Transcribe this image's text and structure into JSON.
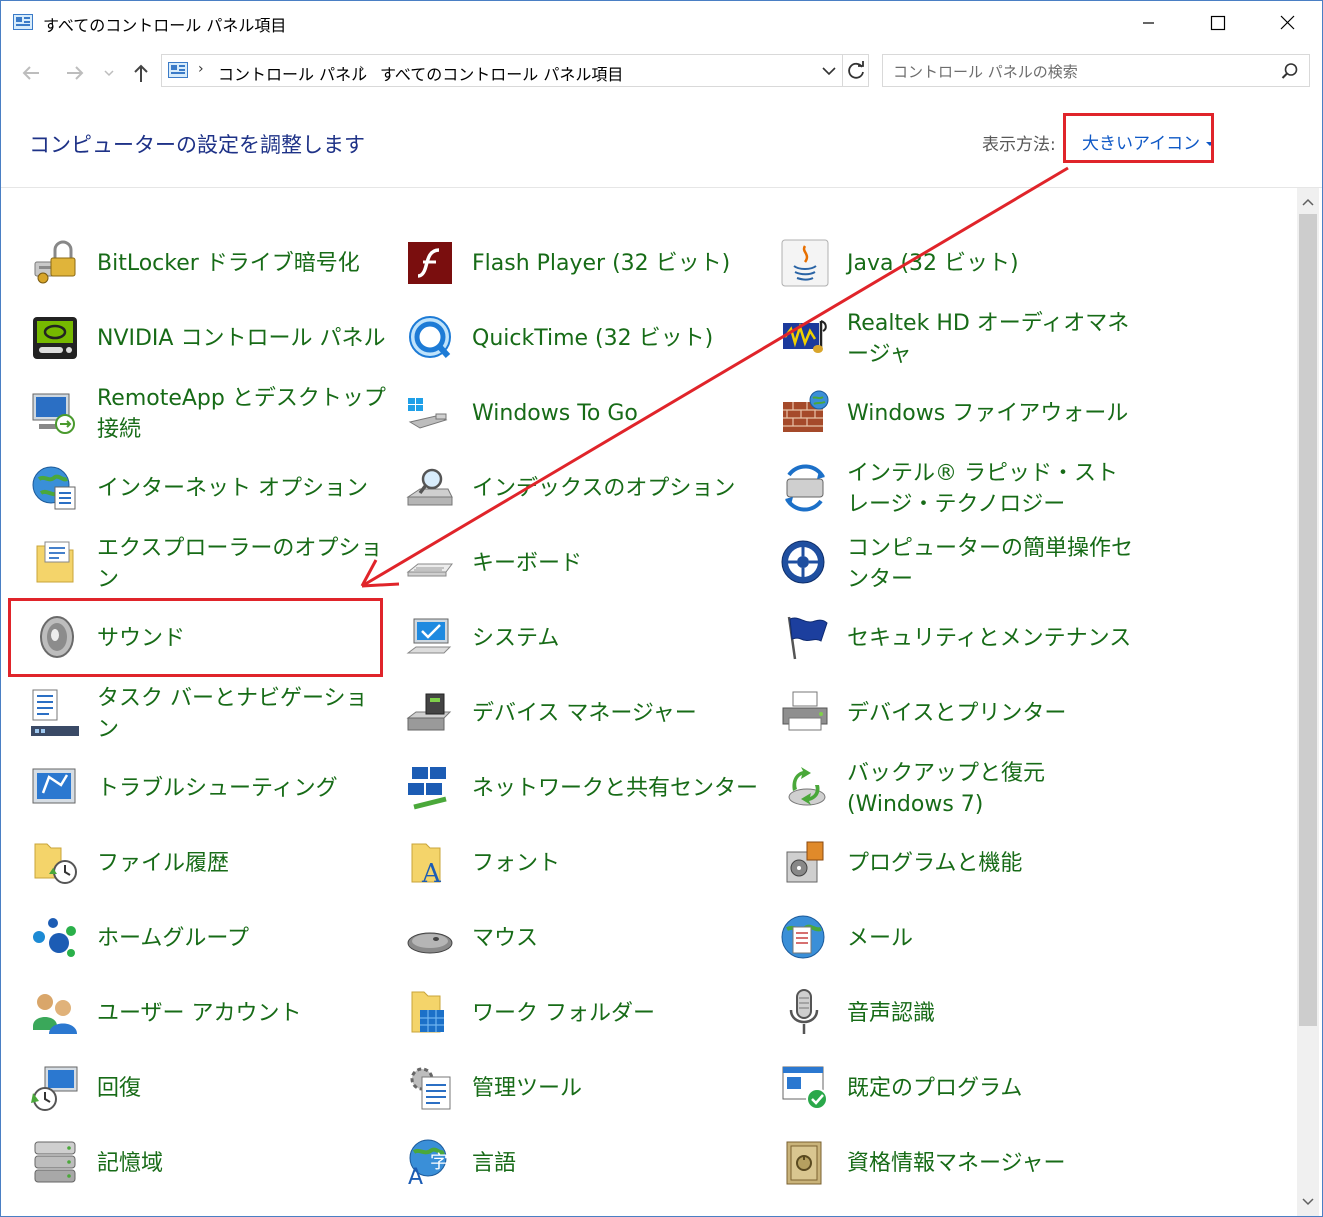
{
  "window": {
    "title": "すべてのコントロール パネル項目",
    "icon": "control-panel-icon"
  },
  "address_bar": {
    "crumbs": [
      "コントロール パネル",
      "すべてのコントロール パネル項目"
    ],
    "separator": "›"
  },
  "search": {
    "placeholder": "コントロール パネルの検索"
  },
  "header": {
    "title": "コンピューターの設定を調整します",
    "view_by_label": "表示方法:",
    "view_by_value": "大きいアイコン"
  },
  "items": [
    {
      "label": "BitLocker ドライブ暗号化",
      "icon": "bitlocker-icon"
    },
    {
      "label": "Flash Player (32 ビット)",
      "icon": "flash-player-icon"
    },
    {
      "label": "Java (32 ビット)",
      "icon": "java-icon"
    },
    {
      "label": "NVIDIA コントロール パネル",
      "icon": "nvidia-icon"
    },
    {
      "label": "QuickTime (32 ビット)",
      "icon": "quicktime-icon"
    },
    {
      "label": "Realtek HD オーディオマネージャ",
      "icon": "realtek-audio-icon"
    },
    {
      "label": "RemoteApp とデスクトップ接続",
      "icon": "remote-desktop-icon"
    },
    {
      "label": "Windows To Go",
      "icon": "usb-drive-icon"
    },
    {
      "label": "Windows ファイアウォール",
      "icon": "firewall-icon"
    },
    {
      "label": "インターネット オプション",
      "icon": "globe-icon"
    },
    {
      "label": "インデックスのオプション",
      "icon": "indexing-icon"
    },
    {
      "label": "インテル® ラピッド・ストレージ・テクノロジー",
      "icon": "intel-storage-icon"
    },
    {
      "label": "エクスプローラーのオプション",
      "icon": "folder-options-icon"
    },
    {
      "label": "キーボード",
      "icon": "keyboard-icon"
    },
    {
      "label": "コンピューターの簡単操作センター",
      "icon": "ease-of-access-icon"
    },
    {
      "label": "サウンド",
      "icon": "speaker-icon"
    },
    {
      "label": "システム",
      "icon": "system-icon"
    },
    {
      "label": "セキュリティとメンテナンス",
      "icon": "flag-icon"
    },
    {
      "label": "タスク バーとナビゲーション",
      "icon": "taskbar-icon"
    },
    {
      "label": "デバイス マネージャー",
      "icon": "device-manager-icon"
    },
    {
      "label": "デバイスとプリンター",
      "icon": "printer-icon"
    },
    {
      "label": "トラブルシューティング",
      "icon": "troubleshoot-icon"
    },
    {
      "label": "ネットワークと共有センター",
      "icon": "network-icon"
    },
    {
      "label": "バックアップと復元 (Windows 7)",
      "icon": "backup-icon"
    },
    {
      "label": "ファイル履歴",
      "icon": "file-history-icon"
    },
    {
      "label": "フォント",
      "icon": "fonts-icon"
    },
    {
      "label": "プログラムと機能",
      "icon": "programs-icon"
    },
    {
      "label": "ホームグループ",
      "icon": "homegroup-icon"
    },
    {
      "label": "マウス",
      "icon": "mouse-icon"
    },
    {
      "label": "メール",
      "icon": "mail-icon"
    },
    {
      "label": "ユーザー アカウント",
      "icon": "user-accounts-icon"
    },
    {
      "label": "ワーク フォルダー",
      "icon": "work-folders-icon"
    },
    {
      "label": "音声認識",
      "icon": "microphone-icon"
    },
    {
      "label": "回復",
      "icon": "recovery-icon"
    },
    {
      "label": "管理ツール",
      "icon": "admin-tools-icon"
    },
    {
      "label": "既定のプログラム",
      "icon": "default-programs-icon"
    },
    {
      "label": "記憶域",
      "icon": "storage-spaces-icon"
    },
    {
      "label": "言語",
      "icon": "language-icon"
    },
    {
      "label": "資格情報マネージャー",
      "icon": "credential-manager-icon"
    }
  ],
  "colors": {
    "link_green": "#176b17",
    "heading_blue": "#1e3287",
    "accent_blue": "#0e58c6",
    "annotation_red": "#e0242a"
  }
}
